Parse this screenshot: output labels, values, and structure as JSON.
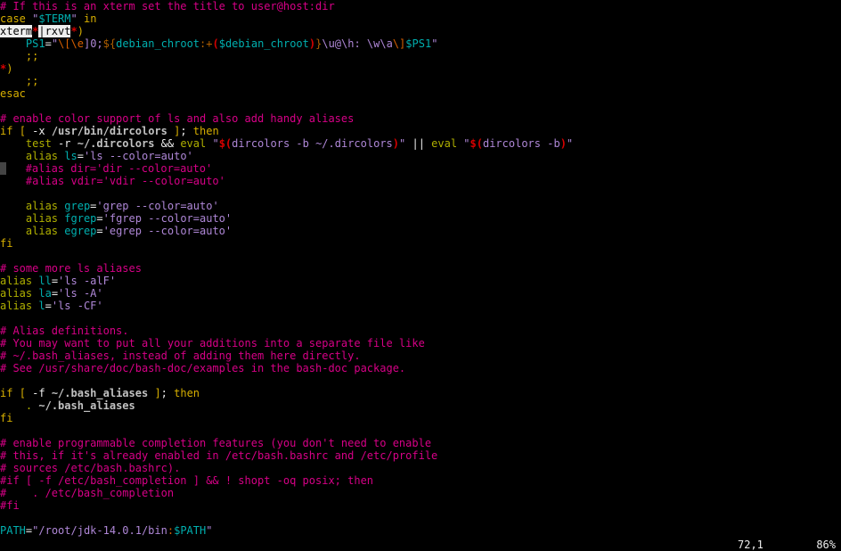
{
  "lines": [
    [
      {
        "c": "c-comment",
        "t": "# If this is an xterm set the title to user@host:dir"
      }
    ],
    [
      {
        "c": "c-keyword",
        "t": "case"
      },
      {
        "c": "c-white",
        "t": " "
      },
      {
        "c": "c-string",
        "t": "\""
      },
      {
        "c": "c-cyan",
        "t": "$TERM"
      },
      {
        "c": "c-string",
        "t": "\""
      },
      {
        "c": "c-white",
        "t": " "
      },
      {
        "c": "c-keyword",
        "t": "in"
      }
    ],
    [
      {
        "c": "c-whitebg",
        "t": "xterm"
      },
      {
        "c": "c-redbold",
        "t": "*"
      },
      {
        "c": "c-whitebg",
        "t": "|rxvt"
      },
      {
        "c": "c-redbold",
        "t": "*"
      },
      {
        "c": "c-keyword",
        "t": ")"
      }
    ],
    [
      {
        "c": "c-white",
        "t": "    "
      },
      {
        "c": "c-cyan",
        "t": "PS1"
      },
      {
        "c": "c-white",
        "t": "="
      },
      {
        "c": "c-string",
        "t": "\""
      },
      {
        "c": "c-red",
        "t": "\\[\\e"
      },
      {
        "c": "c-string",
        "t": "]0;"
      },
      {
        "c": "c-brace",
        "t": "${"
      },
      {
        "c": "c-cyan",
        "t": "debian_chroot"
      },
      {
        "c": "c-brace",
        "t": ":+"
      },
      {
        "c": "c-redbold",
        "t": "("
      },
      {
        "c": "c-cyan",
        "t": "$debian_chroot"
      },
      {
        "c": "c-redbold",
        "t": ")"
      },
      {
        "c": "c-brace",
        "t": "}"
      },
      {
        "c": "c-string",
        "t": "\\u@\\h: \\w\\a"
      },
      {
        "c": "c-red",
        "t": "\\]"
      },
      {
        "c": "c-cyan",
        "t": "$PS1"
      },
      {
        "c": "c-string",
        "t": "\""
      }
    ],
    [
      {
        "c": "c-white",
        "t": "    "
      },
      {
        "c": "c-keyword",
        "t": ";;"
      }
    ],
    [
      {
        "c": "c-redbold",
        "t": "*"
      },
      {
        "c": "c-keyword",
        "t": ")"
      }
    ],
    [
      {
        "c": "c-white",
        "t": "    "
      },
      {
        "c": "c-keyword",
        "t": ";;"
      }
    ],
    [
      {
        "c": "c-keyword",
        "t": "esac"
      }
    ],
    [],
    [
      {
        "c": "c-comment",
        "t": "# enable color support of ls and also add handy aliases"
      }
    ],
    [
      {
        "c": "c-keyword",
        "t": "if"
      },
      {
        "c": "c-white",
        "t": " "
      },
      {
        "c": "c-keyword",
        "t": "["
      },
      {
        "c": "c-white",
        "t": " -x "
      },
      {
        "c": "c-path",
        "t": "/usr/bin/dircolors"
      },
      {
        "c": "c-white",
        "t": " "
      },
      {
        "c": "c-keyword",
        "t": "]"
      },
      {
        "c": "c-white",
        "t": "; "
      },
      {
        "c": "c-keyword",
        "t": "then"
      }
    ],
    [
      {
        "c": "c-white",
        "t": "    "
      },
      {
        "c": "c-yellow",
        "t": "test"
      },
      {
        "c": "c-white",
        "t": " -r "
      },
      {
        "c": "c-path",
        "t": "~/.dircolors"
      },
      {
        "c": "c-white",
        "t": " && "
      },
      {
        "c": "c-yellow",
        "t": "eval"
      },
      {
        "c": "c-white",
        "t": " "
      },
      {
        "c": "c-string",
        "t": "\""
      },
      {
        "c": "c-redbold",
        "t": "$("
      },
      {
        "c": "c-string",
        "t": "dircolors -b ~/.dircolors"
      },
      {
        "c": "c-redbold",
        "t": ")"
      },
      {
        "c": "c-string",
        "t": "\""
      },
      {
        "c": "c-white",
        "t": " || "
      },
      {
        "c": "c-yellow",
        "t": "eval"
      },
      {
        "c": "c-white",
        "t": " "
      },
      {
        "c": "c-string",
        "t": "\""
      },
      {
        "c": "c-redbold",
        "t": "$("
      },
      {
        "c": "c-string",
        "t": "dircolors -b"
      },
      {
        "c": "c-redbold",
        "t": ")"
      },
      {
        "c": "c-string",
        "t": "\""
      }
    ],
    [
      {
        "c": "c-white",
        "t": "    "
      },
      {
        "c": "c-yellow",
        "t": "alias"
      },
      {
        "c": "c-white",
        "t": " "
      },
      {
        "c": "c-cyan",
        "t": "ls"
      },
      {
        "c": "c-white",
        "t": "="
      },
      {
        "c": "c-string",
        "t": "'ls --color=auto'"
      }
    ],
    [
      {
        "c": "cursor",
        "t": " "
      },
      {
        "c": "c-white",
        "t": "   "
      },
      {
        "c": "c-comment",
        "t": "#alias dir='dir --color=auto'"
      }
    ],
    [
      {
        "c": "c-white",
        "t": "    "
      },
      {
        "c": "c-comment",
        "t": "#alias vdir='vdir --color=auto'"
      }
    ],
    [],
    [
      {
        "c": "c-white",
        "t": "    "
      },
      {
        "c": "c-yellow",
        "t": "alias"
      },
      {
        "c": "c-white",
        "t": " "
      },
      {
        "c": "c-cyan",
        "t": "grep"
      },
      {
        "c": "c-white",
        "t": "="
      },
      {
        "c": "c-string",
        "t": "'grep --color=auto'"
      }
    ],
    [
      {
        "c": "c-white",
        "t": "    "
      },
      {
        "c": "c-yellow",
        "t": "alias"
      },
      {
        "c": "c-white",
        "t": " "
      },
      {
        "c": "c-cyan",
        "t": "fgrep"
      },
      {
        "c": "c-white",
        "t": "="
      },
      {
        "c": "c-string",
        "t": "'fgrep --color=auto'"
      }
    ],
    [
      {
        "c": "c-white",
        "t": "    "
      },
      {
        "c": "c-yellow",
        "t": "alias"
      },
      {
        "c": "c-white",
        "t": " "
      },
      {
        "c": "c-cyan",
        "t": "egrep"
      },
      {
        "c": "c-white",
        "t": "="
      },
      {
        "c": "c-string",
        "t": "'egrep --color=auto'"
      }
    ],
    [
      {
        "c": "c-keyword",
        "t": "fi"
      }
    ],
    [],
    [
      {
        "c": "c-comment",
        "t": "# some more ls aliases"
      }
    ],
    [
      {
        "c": "c-yellow",
        "t": "alias"
      },
      {
        "c": "c-white",
        "t": " "
      },
      {
        "c": "c-cyan",
        "t": "ll"
      },
      {
        "c": "c-white",
        "t": "="
      },
      {
        "c": "c-string",
        "t": "'ls -alF'"
      }
    ],
    [
      {
        "c": "c-yellow",
        "t": "alias"
      },
      {
        "c": "c-white",
        "t": " "
      },
      {
        "c": "c-cyan",
        "t": "la"
      },
      {
        "c": "c-white",
        "t": "="
      },
      {
        "c": "c-string",
        "t": "'ls -A'"
      }
    ],
    [
      {
        "c": "c-yellow",
        "t": "alias"
      },
      {
        "c": "c-white",
        "t": " "
      },
      {
        "c": "c-cyan",
        "t": "l"
      },
      {
        "c": "c-white",
        "t": "="
      },
      {
        "c": "c-string",
        "t": "'ls -CF'"
      }
    ],
    [],
    [
      {
        "c": "c-comment",
        "t": "# Alias definitions."
      }
    ],
    [
      {
        "c": "c-comment",
        "t": "# You may want to put all your additions into a separate file like"
      }
    ],
    [
      {
        "c": "c-comment",
        "t": "# ~/.bash_aliases, instead of adding them here directly."
      }
    ],
    [
      {
        "c": "c-comment",
        "t": "# See /usr/share/doc/bash-doc/examples in the bash-doc package."
      }
    ],
    [],
    [
      {
        "c": "c-keyword",
        "t": "if"
      },
      {
        "c": "c-white",
        "t": " "
      },
      {
        "c": "c-keyword",
        "t": "["
      },
      {
        "c": "c-white",
        "t": " -f "
      },
      {
        "c": "c-path",
        "t": "~/.bash_aliases"
      },
      {
        "c": "c-white",
        "t": " "
      },
      {
        "c": "c-keyword",
        "t": "]"
      },
      {
        "c": "c-white",
        "t": "; "
      },
      {
        "c": "c-keyword",
        "t": "then"
      }
    ],
    [
      {
        "c": "c-white",
        "t": "    "
      },
      {
        "c": "c-yellow",
        "t": "."
      },
      {
        "c": "c-white",
        "t": " "
      },
      {
        "c": "c-path",
        "t": "~/.bash_aliases"
      }
    ],
    [
      {
        "c": "c-keyword",
        "t": "fi"
      }
    ],
    [],
    [
      {
        "c": "c-comment",
        "t": "# enable programmable completion features (you don't need to enable"
      }
    ],
    [
      {
        "c": "c-comment",
        "t": "# this, if it's already enabled in /etc/bash.bashrc and /etc/profile"
      }
    ],
    [
      {
        "c": "c-comment",
        "t": "# sources /etc/bash.bashrc)."
      }
    ],
    [
      {
        "c": "c-comment",
        "t": "#if [ -f /etc/bash_completion ] && ! shopt -oq posix; then"
      }
    ],
    [
      {
        "c": "c-comment",
        "t": "#    . /etc/bash_completion"
      }
    ],
    [
      {
        "c": "c-comment",
        "t": "#fi"
      }
    ],
    [],
    [
      {
        "c": "c-cyan",
        "t": "PATH"
      },
      {
        "c": "c-white",
        "t": "="
      },
      {
        "c": "c-string",
        "t": "\"/root/jdk-14.0.1/bin"
      },
      {
        "c": "c-red",
        "t": ":"
      },
      {
        "c": "c-cyan",
        "t": "$PATH"
      },
      {
        "c": "c-string",
        "t": "\""
      }
    ]
  ],
  "status": {
    "pos": "72,1",
    "pct": "86%"
  }
}
